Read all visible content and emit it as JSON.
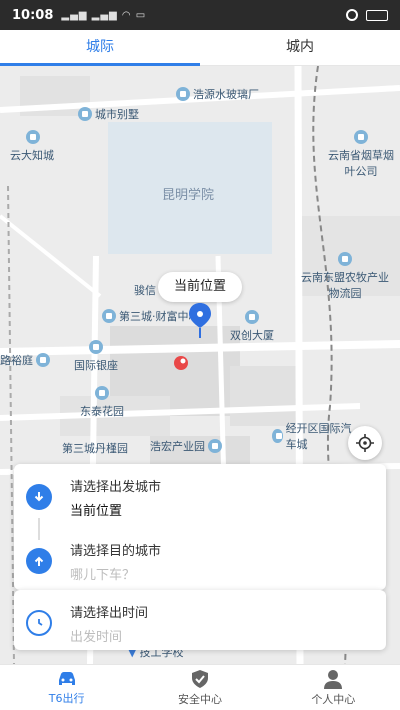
{
  "status_bar": {
    "time": "10:08"
  },
  "tabs": [
    {
      "label": "城际",
      "active": true
    },
    {
      "label": "城内",
      "active": false
    }
  ],
  "map": {
    "campus_label": "昆明学院",
    "location_tip": "当前位置",
    "pois": [
      "浩源水玻璃厂",
      "城市别墅",
      "云大知城",
      "云南省烟草烟叶公司",
      "骏信",
      "第三城·财富中心",
      "双创大厦",
      "路裕庭",
      "国际银座",
      "云南东盟农牧产业物流园",
      "东泰花园",
      "第三城丹槿园",
      "浩宏产业园",
      "经开区国际汽车城",
      "技工学校"
    ]
  },
  "trip": {
    "departure": {
      "title": "请选择出发城市",
      "value": "当前位置"
    },
    "destination": {
      "title": "请选择目的城市",
      "placeholder": "哪儿下车？"
    },
    "time": {
      "title": "请选择出时间",
      "placeholder": "出发时间"
    }
  },
  "bottom_nav": [
    {
      "label": "T6出行",
      "active": true
    },
    {
      "label": "安全中心",
      "active": false
    },
    {
      "label": "个人中心",
      "active": false
    }
  ],
  "colors": {
    "accent": "#2f7ee8",
    "marker_red": "#e94848"
  }
}
